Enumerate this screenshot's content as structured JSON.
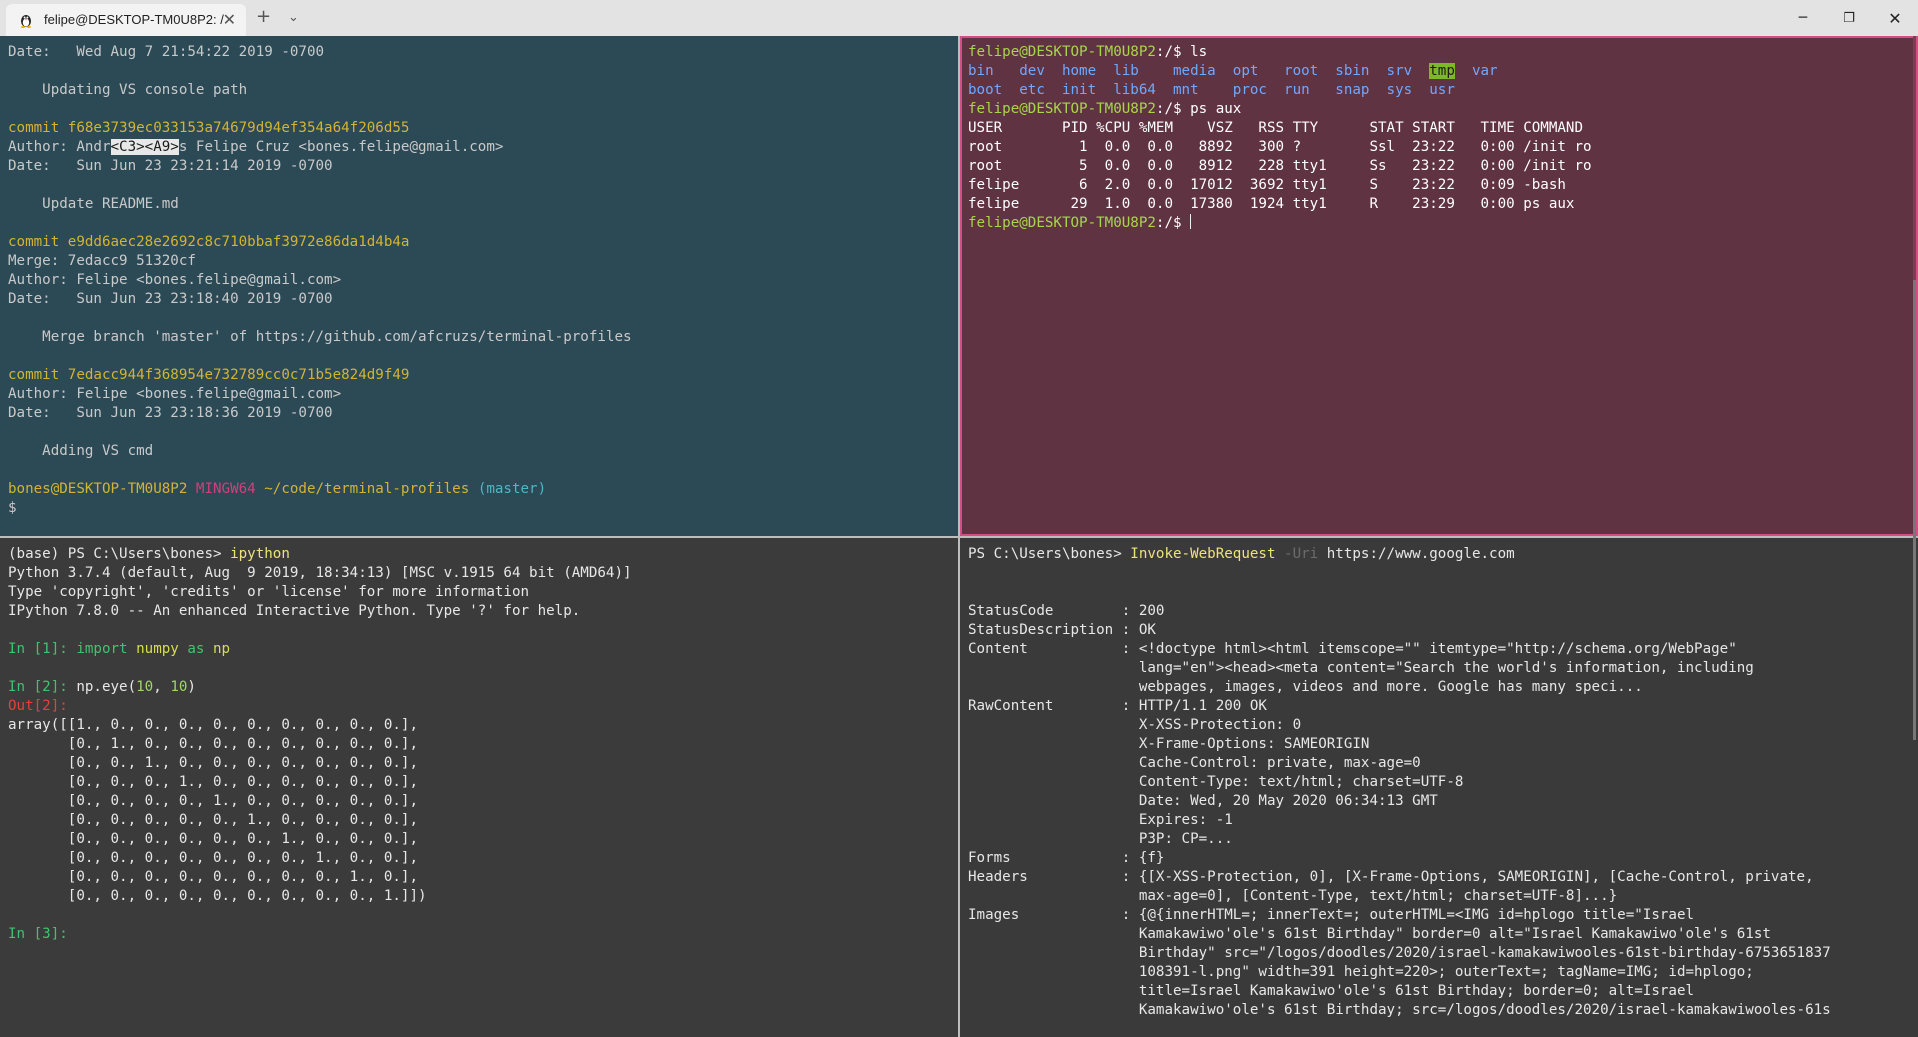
{
  "window": {
    "tab_title": "felipe@DESKTOP-TM0U8P2: /",
    "tab_icon": "tux-linux-icon",
    "new_tab_label": "+",
    "dropdown_label": "⌄",
    "minimize_label": "─",
    "maximize_label": "❐",
    "close_label": "✕",
    "tab_close_label": "✕"
  },
  "panes": {
    "git": {
      "lines": [
        [
          {
            "t": "Date:   Wed Aug 7 21:54:22 2019 -0700"
          }
        ],
        [
          {
            "t": ""
          }
        ],
        [
          {
            "t": "    Updating VS console path"
          }
        ],
        [
          {
            "t": ""
          }
        ],
        [
          {
            "t": "commit f68e3739ec033153a74679d94ef354a64f206d55",
            "c": "c-yellow"
          }
        ],
        [
          {
            "t": "Author: Andr"
          },
          {
            "t": "<C3><A9>",
            "c": "inv"
          },
          {
            "t": "s Felipe Cruz <bones.felipe@gmail.com>"
          }
        ],
        [
          {
            "t": "Date:   Sun Jun 23 23:21:14 2019 -0700"
          }
        ],
        [
          {
            "t": ""
          }
        ],
        [
          {
            "t": "    Update README.md"
          }
        ],
        [
          {
            "t": ""
          }
        ],
        [
          {
            "t": "commit e9dd6aec28e2692c8c710bbaf3972e86da1d4b4a",
            "c": "c-yellow"
          }
        ],
        [
          {
            "t": "Merge: 7edacc9 51320cf"
          }
        ],
        [
          {
            "t": "Author: Felipe <bones.felipe@gmail.com>"
          }
        ],
        [
          {
            "t": "Date:   Sun Jun 23 23:18:40 2019 -0700"
          }
        ],
        [
          {
            "t": ""
          }
        ],
        [
          {
            "t": "    Merge branch 'master' of https://github.com/afcruzs/terminal-profiles"
          }
        ],
        [
          {
            "t": ""
          }
        ],
        [
          {
            "t": "commit 7edacc944f368954e732789cc0c71b5e824d9f49",
            "c": "c-yellow"
          }
        ],
        [
          {
            "t": "Author: Felipe <bones.felipe@gmail.com>"
          }
        ],
        [
          {
            "t": "Date:   Sun Jun 23 23:18:36 2019 -0700"
          }
        ],
        [
          {
            "t": ""
          }
        ],
        [
          {
            "t": "    Adding VS cmd"
          }
        ],
        [
          {
            "t": ""
          }
        ],
        [
          {
            "t": "bones@DESKTOP-TM0U8P2 ",
            "c": "c-yellow"
          },
          {
            "t": "MINGW64 ",
            "c": "c-pink"
          },
          {
            "t": "~/code/terminal-profiles ",
            "c": "c-yellow"
          },
          {
            "t": "(master)",
            "c": "c-cyan"
          }
        ],
        [
          {
            "t": "$"
          }
        ]
      ]
    },
    "linux": {
      "lines": [
        [
          {
            "t": "felipe@DESKTOP-TM0U8P2",
            "c": "c-green"
          },
          {
            "t": ":/$ ls"
          }
        ],
        [
          {
            "t": "bin   dev  home  lib    media  opt   root  sbin  srv  ",
            "c": "c-blue"
          },
          {
            "t": "tmp",
            "c": "hl-tmp"
          },
          {
            "t": "  var",
            "c": "c-blue"
          }
        ],
        [
          {
            "t": "boot  etc  init  lib64  mnt    proc  run   snap  sys  usr",
            "c": "c-blue"
          }
        ],
        [
          {
            "t": "felipe@DESKTOP-TM0U8P2",
            "c": "c-green"
          },
          {
            "t": ":/$ ps aux"
          }
        ],
        [
          {
            "t": "USER       PID %CPU %MEM    VSZ   RSS TTY      STAT START   TIME COMMAND"
          }
        ],
        [
          {
            "t": "root         1  0.0  0.0   8892   300 ?        Ssl  23:22   0:00 /init ro"
          }
        ],
        [
          {
            "t": "root         5  0.0  0.0   8912   228 tty1     Ss   23:22   0:00 /init ro"
          }
        ],
        [
          {
            "t": "felipe       6  2.0  0.0  17012  3692 tty1     S    23:22   0:09 -bash"
          }
        ],
        [
          {
            "t": "felipe      29  1.0  0.0  17380  1924 tty1     R    23:29   0:00 ps aux"
          }
        ],
        [
          {
            "t": "felipe@DESKTOP-TM0U8P2",
            "c": "c-green"
          },
          {
            "t": ":/$ "
          },
          {
            "t": "",
            "cursor": true
          }
        ]
      ]
    },
    "python": {
      "lines": [
        [
          {
            "t": "(base) PS C:\\Users\\bones> "
          },
          {
            "t": "ipython",
            "c": "c-pskw"
          }
        ],
        [
          {
            "t": "Python 3.7.4 (default, Aug  9 2019, 18:34:13) [MSC v.1915 64 bit (AMD64)]"
          }
        ],
        [
          {
            "t": "Type 'copyright', 'credits' or 'license' for more information"
          }
        ],
        [
          {
            "t": "IPython 7.8.0 -- An enhanced Interactive Python. Type '?' for help."
          }
        ],
        [
          {
            "t": ""
          }
        ],
        [
          {
            "t": "In [",
            "c": "c-lgreen"
          },
          {
            "t": "1",
            "c": "c-lgreen"
          },
          {
            "t": "]: ",
            "c": "c-lgreen"
          },
          {
            "t": "import ",
            "c": "c-lgreen"
          },
          {
            "t": "numpy ",
            "c": "c-ygreen"
          },
          {
            "t": "as ",
            "c": "c-lgreen"
          },
          {
            "t": "np",
            "c": "c-ygreen"
          }
        ],
        [
          {
            "t": ""
          }
        ],
        [
          {
            "t": "In [2]: ",
            "c": "c-lgreen"
          },
          {
            "t": "np.eye("
          },
          {
            "t": "10",
            "c": "c-num"
          },
          {
            "t": ", "
          },
          {
            "t": "10",
            "c": "c-num"
          },
          {
            "t": ")"
          }
        ],
        [
          {
            "t": "Out[2]:",
            "c": "c-red"
          }
        ],
        [
          {
            "t": "array([[1., 0., 0., 0., 0., 0., 0., 0., 0., 0.],"
          }
        ],
        [
          {
            "t": "       [0., 1., 0., 0., 0., 0., 0., 0., 0., 0.],"
          }
        ],
        [
          {
            "t": "       [0., 0., 1., 0., 0., 0., 0., 0., 0., 0.],"
          }
        ],
        [
          {
            "t": "       [0., 0., 0., 1., 0., 0., 0., 0., 0., 0.],"
          }
        ],
        [
          {
            "t": "       [0., 0., 0., 0., 1., 0., 0., 0., 0., 0.],"
          }
        ],
        [
          {
            "t": "       [0., 0., 0., 0., 0., 1., 0., 0., 0., 0.],"
          }
        ],
        [
          {
            "t": "       [0., 0., 0., 0., 0., 0., 1., 0., 0., 0.],"
          }
        ],
        [
          {
            "t": "       [0., 0., 0., 0., 0., 0., 0., 1., 0., 0.],"
          }
        ],
        [
          {
            "t": "       [0., 0., 0., 0., 0., 0., 0., 0., 1., 0.],"
          }
        ],
        [
          {
            "t": "       [0., 0., 0., 0., 0., 0., 0., 0., 0., 1.]])"
          }
        ],
        [
          {
            "t": ""
          }
        ],
        [
          {
            "t": "In [3]:",
            "c": "c-lgreen"
          }
        ]
      ]
    },
    "powershell": {
      "lines": [
        [
          {
            "t": "PS C:\\Users\\bones> "
          },
          {
            "t": "Invoke-WebRequest ",
            "c": "c-pskw"
          },
          {
            "t": "-Uri ",
            "c": "c-dim"
          },
          {
            "t": "https://www.google.com"
          }
        ],
        [
          {
            "t": ""
          }
        ],
        [
          {
            "t": ""
          }
        ],
        [
          {
            "t": "StatusCode        : 200"
          }
        ],
        [
          {
            "t": "StatusDescription : OK"
          }
        ],
        [
          {
            "t": "Content           : <!doctype html><html itemscope=\"\" itemtype=\"http://schema.org/WebPage\""
          }
        ],
        [
          {
            "t": "                    lang=\"en\"><head><meta content=\"Search the world's information, including"
          }
        ],
        [
          {
            "t": "                    webpages, images, videos and more. Google has many speci..."
          }
        ],
        [
          {
            "t": "RawContent        : HTTP/1.1 200 OK"
          }
        ],
        [
          {
            "t": "                    X-XSS-Protection: 0"
          }
        ],
        [
          {
            "t": "                    X-Frame-Options: SAMEORIGIN"
          }
        ],
        [
          {
            "t": "                    Cache-Control: private, max-age=0"
          }
        ],
        [
          {
            "t": "                    Content-Type: text/html; charset=UTF-8"
          }
        ],
        [
          {
            "t": "                    Date: Wed, 20 May 2020 06:34:13 GMT"
          }
        ],
        [
          {
            "t": "                    Expires: -1"
          }
        ],
        [
          {
            "t": "                    P3P: CP=..."
          }
        ],
        [
          {
            "t": "Forms             : {f}"
          }
        ],
        [
          {
            "t": "Headers           : {[X-XSS-Protection, 0], [X-Frame-Options, SAMEORIGIN], [Cache-Control, private,"
          }
        ],
        [
          {
            "t": "                    max-age=0], [Content-Type, text/html; charset=UTF-8]...}"
          }
        ],
        [
          {
            "t": "Images            : {@{innerHTML=; innerText=; outerHTML=<IMG id=hplogo title=\"Israel"
          }
        ],
        [
          {
            "t": "                    Kamakawiwo'ole's 61st Birthday\" border=0 alt=\"Israel Kamakawiwo'ole's 61st"
          }
        ],
        [
          {
            "t": "                    Birthday\" src=\"/logos/doodles/2020/israel-kamakawiwooles-61st-birthday-6753651837"
          }
        ],
        [
          {
            "t": "                    108391-l.png\" width=391 height=220>; outerText=; tagName=IMG; id=hplogo;"
          }
        ],
        [
          {
            "t": "                    title=Israel Kamakawiwo'ole's 61st Birthday; border=0; alt=Israel"
          }
        ],
        [
          {
            "t": "                    Kamakawiwo'ole's 61st Birthday; src=/logos/doodles/2020/israel-kamakawiwooles-61s"
          }
        ]
      ]
    }
  }
}
